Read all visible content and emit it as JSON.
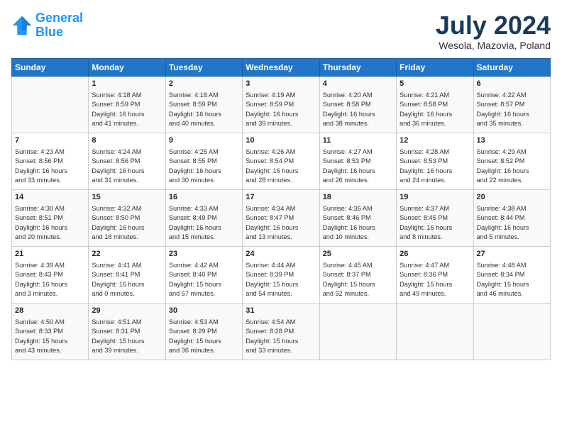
{
  "header": {
    "logo_line1": "General",
    "logo_line2": "Blue",
    "month_title": "July 2024",
    "location": "Wesola, Mazovia, Poland"
  },
  "days_of_week": [
    "Sunday",
    "Monday",
    "Tuesday",
    "Wednesday",
    "Thursday",
    "Friday",
    "Saturday"
  ],
  "weeks": [
    [
      {
        "num": "",
        "info": ""
      },
      {
        "num": "1",
        "info": "Sunrise: 4:18 AM\nSunset: 8:59 PM\nDaylight: 16 hours\nand 41 minutes."
      },
      {
        "num": "2",
        "info": "Sunrise: 4:18 AM\nSunset: 8:59 PM\nDaylight: 16 hours\nand 40 minutes."
      },
      {
        "num": "3",
        "info": "Sunrise: 4:19 AM\nSunset: 8:59 PM\nDaylight: 16 hours\nand 39 minutes."
      },
      {
        "num": "4",
        "info": "Sunrise: 4:20 AM\nSunset: 8:58 PM\nDaylight: 16 hours\nand 38 minutes."
      },
      {
        "num": "5",
        "info": "Sunrise: 4:21 AM\nSunset: 8:58 PM\nDaylight: 16 hours\nand 36 minutes."
      },
      {
        "num": "6",
        "info": "Sunrise: 4:22 AM\nSunset: 8:57 PM\nDaylight: 16 hours\nand 35 minutes."
      }
    ],
    [
      {
        "num": "7",
        "info": "Sunrise: 4:23 AM\nSunset: 8:56 PM\nDaylight: 16 hours\nand 33 minutes."
      },
      {
        "num": "8",
        "info": "Sunrise: 4:24 AM\nSunset: 8:56 PM\nDaylight: 16 hours\nand 31 minutes."
      },
      {
        "num": "9",
        "info": "Sunrise: 4:25 AM\nSunset: 8:55 PM\nDaylight: 16 hours\nand 30 minutes."
      },
      {
        "num": "10",
        "info": "Sunrise: 4:26 AM\nSunset: 8:54 PM\nDaylight: 16 hours\nand 28 minutes."
      },
      {
        "num": "11",
        "info": "Sunrise: 4:27 AM\nSunset: 8:53 PM\nDaylight: 16 hours\nand 26 minutes."
      },
      {
        "num": "12",
        "info": "Sunrise: 4:28 AM\nSunset: 8:53 PM\nDaylight: 16 hours\nand 24 minutes."
      },
      {
        "num": "13",
        "info": "Sunrise: 4:29 AM\nSunset: 8:52 PM\nDaylight: 16 hours\nand 22 minutes."
      }
    ],
    [
      {
        "num": "14",
        "info": "Sunrise: 4:30 AM\nSunset: 8:51 PM\nDaylight: 16 hours\nand 20 minutes."
      },
      {
        "num": "15",
        "info": "Sunrise: 4:32 AM\nSunset: 8:50 PM\nDaylight: 16 hours\nand 18 minutes."
      },
      {
        "num": "16",
        "info": "Sunrise: 4:33 AM\nSunset: 8:49 PM\nDaylight: 16 hours\nand 15 minutes."
      },
      {
        "num": "17",
        "info": "Sunrise: 4:34 AM\nSunset: 8:47 PM\nDaylight: 16 hours\nand 13 minutes."
      },
      {
        "num": "18",
        "info": "Sunrise: 4:35 AM\nSunset: 8:46 PM\nDaylight: 16 hours\nand 10 minutes."
      },
      {
        "num": "19",
        "info": "Sunrise: 4:37 AM\nSunset: 8:45 PM\nDaylight: 16 hours\nand 8 minutes."
      },
      {
        "num": "20",
        "info": "Sunrise: 4:38 AM\nSunset: 8:44 PM\nDaylight: 16 hours\nand 5 minutes."
      }
    ],
    [
      {
        "num": "21",
        "info": "Sunrise: 4:39 AM\nSunset: 8:43 PM\nDaylight: 16 hours\nand 3 minutes."
      },
      {
        "num": "22",
        "info": "Sunrise: 4:41 AM\nSunset: 8:41 PM\nDaylight: 16 hours\nand 0 minutes."
      },
      {
        "num": "23",
        "info": "Sunrise: 4:42 AM\nSunset: 8:40 PM\nDaylight: 15 hours\nand 57 minutes."
      },
      {
        "num": "24",
        "info": "Sunrise: 4:44 AM\nSunset: 8:39 PM\nDaylight: 15 hours\nand 54 minutes."
      },
      {
        "num": "25",
        "info": "Sunrise: 4:45 AM\nSunset: 8:37 PM\nDaylight: 15 hours\nand 52 minutes."
      },
      {
        "num": "26",
        "info": "Sunrise: 4:47 AM\nSunset: 8:36 PM\nDaylight: 15 hours\nand 49 minutes."
      },
      {
        "num": "27",
        "info": "Sunrise: 4:48 AM\nSunset: 8:34 PM\nDaylight: 15 hours\nand 46 minutes."
      }
    ],
    [
      {
        "num": "28",
        "info": "Sunrise: 4:50 AM\nSunset: 8:33 PM\nDaylight: 15 hours\nand 43 minutes."
      },
      {
        "num": "29",
        "info": "Sunrise: 4:51 AM\nSunset: 8:31 PM\nDaylight: 15 hours\nand 39 minutes."
      },
      {
        "num": "30",
        "info": "Sunrise: 4:53 AM\nSunset: 8:29 PM\nDaylight: 15 hours\nand 36 minutes."
      },
      {
        "num": "31",
        "info": "Sunrise: 4:54 AM\nSunset: 8:28 PM\nDaylight: 15 hours\nand 33 minutes."
      },
      {
        "num": "",
        "info": ""
      },
      {
        "num": "",
        "info": ""
      },
      {
        "num": "",
        "info": ""
      }
    ]
  ]
}
